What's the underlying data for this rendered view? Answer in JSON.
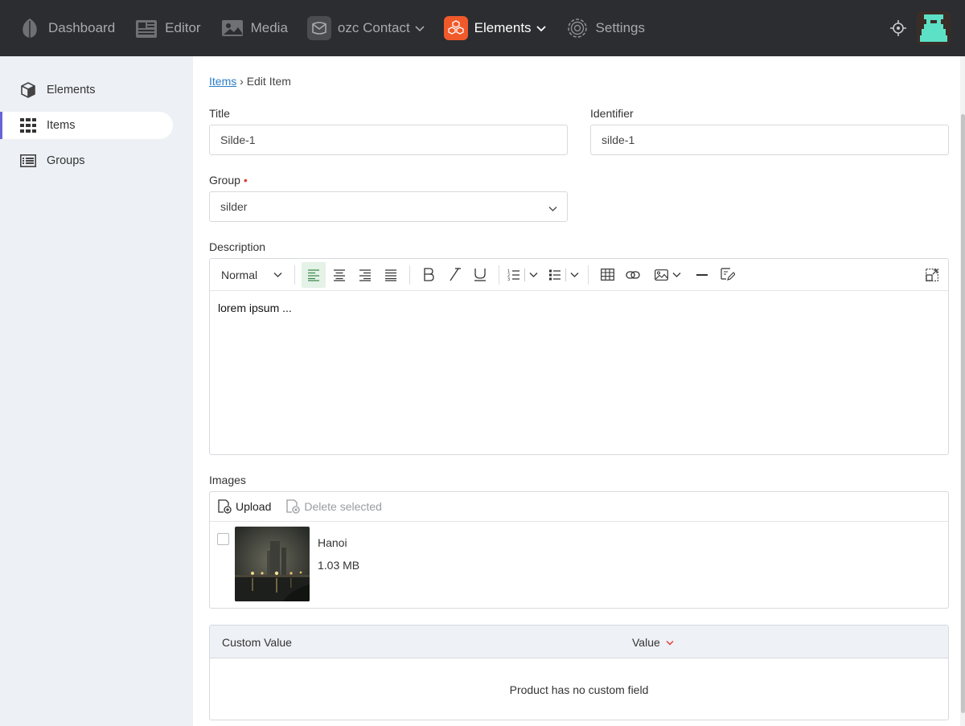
{
  "nav": {
    "items": [
      {
        "label": "Dashboard",
        "icon": "leaf-icon"
      },
      {
        "label": "Editor",
        "icon": "newspaper-icon"
      },
      {
        "label": "Media",
        "icon": "image-icon"
      },
      {
        "label": "ozc Contact",
        "icon": "contact-icon"
      },
      {
        "label": "Elements",
        "icon": "cubes-icon"
      },
      {
        "label": "Settings",
        "icon": "gear-icon"
      }
    ],
    "active": "Elements",
    "accent_color": "#f0592a"
  },
  "sidebar": {
    "items": [
      {
        "label": "Elements",
        "icon": "cube-icon"
      },
      {
        "label": "Items",
        "icon": "grid-icon"
      },
      {
        "label": "Groups",
        "icon": "list-icon"
      }
    ],
    "active": "Items"
  },
  "breadcrumb": {
    "link": "Items",
    "separator": "›",
    "current": "Edit Item"
  },
  "form": {
    "title_label": "Title",
    "title_value": "Silde-1",
    "identifier_label": "Identifier",
    "identifier_value": "silde-1",
    "group_label": "Group",
    "group_required": "•",
    "group_value": "silder",
    "description_label": "Description"
  },
  "editor": {
    "format_value": "Normal",
    "content": "lorem ipsum ..."
  },
  "images": {
    "label": "Images",
    "upload_label": "Upload",
    "delete_label": "Delete selected",
    "items": [
      {
        "name": "Hanoi",
        "size": "1.03 MB"
      }
    ]
  },
  "custom_fields": {
    "col_custom": "Custom Value",
    "col_value": "Value",
    "empty_text": "Product has no custom field"
  }
}
